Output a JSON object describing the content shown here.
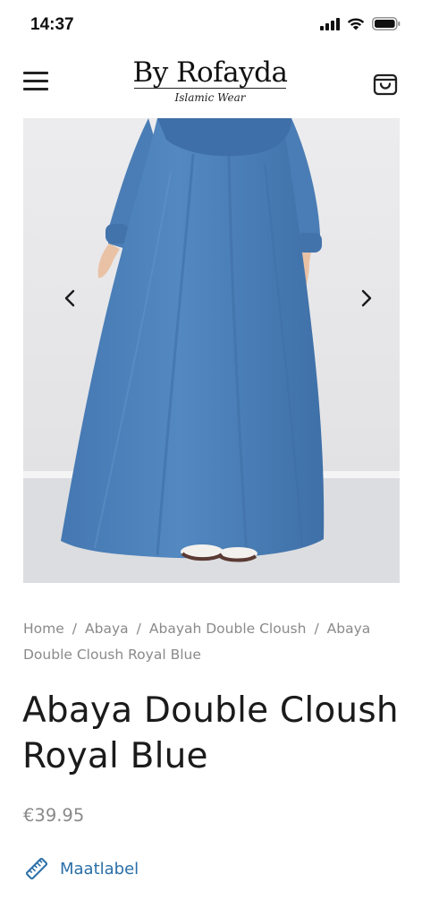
{
  "status_bar": {
    "time": "14:37"
  },
  "header": {
    "logo_title": "By Rofayda",
    "logo_subtitle": "Islamic Wear",
    "menu_icon": "hamburger-icon",
    "cart_icon": "shopping-bag-icon"
  },
  "gallery": {
    "image_subject": "blue abaya on model",
    "dress_color": "#4d7fb7",
    "prev_icon": "chevron-left-icon",
    "next_icon": "chevron-right-icon"
  },
  "breadcrumb": {
    "items": [
      "Home",
      "Abaya",
      "Abayah Double Cloush",
      "Abaya Double Cloush Royal Blue"
    ],
    "separator": "/"
  },
  "product": {
    "title": "Abaya Double Cloush Royal Blue",
    "price": "€39.95"
  },
  "size_guide": {
    "label": "Maatlabel",
    "icon": "ruler-icon",
    "color": "#2b6fa8"
  }
}
